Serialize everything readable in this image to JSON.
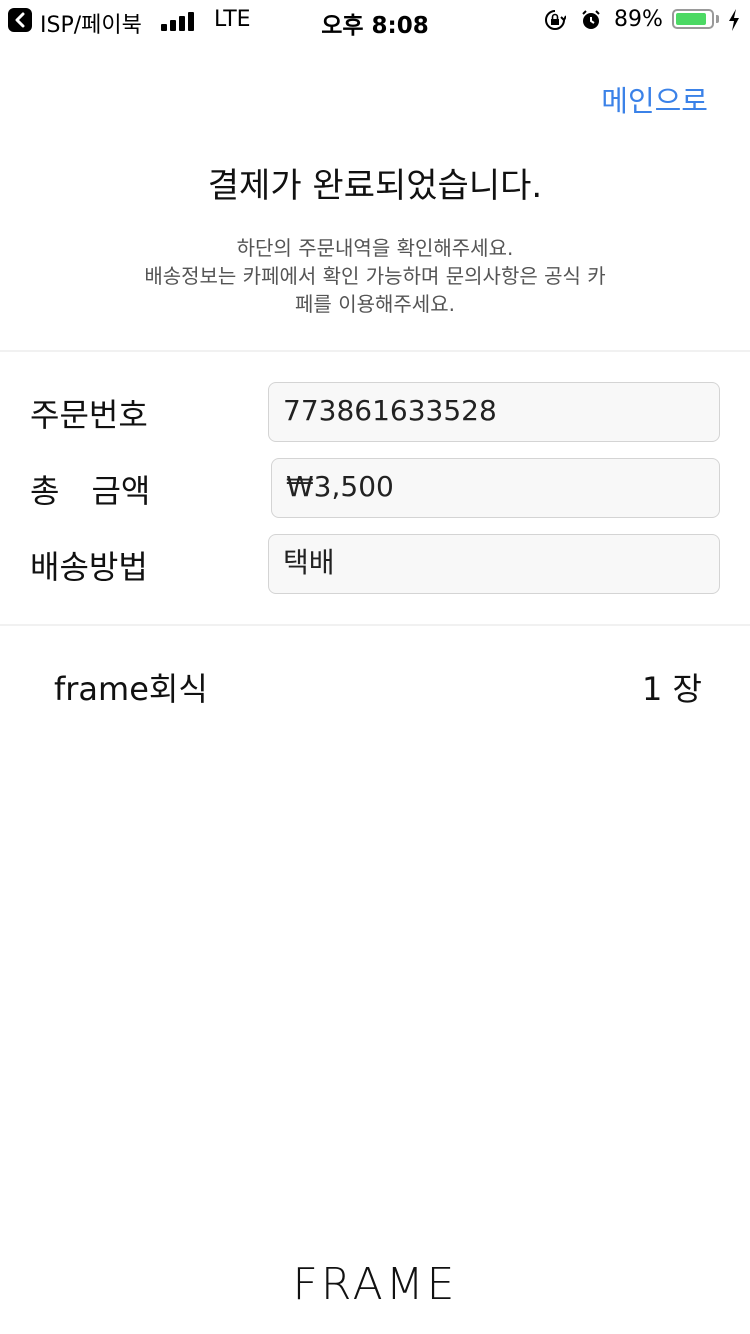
{
  "status_bar": {
    "back_app": "ISP/페이북",
    "network": "LTE",
    "time": "오후 8:08",
    "battery_percent": "89%",
    "battery_level": 0.89,
    "battery_color": "#4cd964"
  },
  "header": {
    "main_link": "메인으로",
    "title": "결제가 완료되었습니다.",
    "description_line1": "하단의 주문내역을 확인해주세요.",
    "description_line2": "배송정보는 카페에서 확인 가능하며 문의사항은 공식 카",
    "description_line3": "페를 이용해주세요."
  },
  "order": {
    "number_label": "주문번호",
    "number_value": "773861633528",
    "total_label": "총　금액",
    "total_value": "₩3,500",
    "shipping_label": "배송방법",
    "shipping_value": "택배"
  },
  "items": [
    {
      "name": "frame회식",
      "quantity": "1 장"
    }
  ],
  "footer": {
    "logo": "FRAME"
  },
  "colors": {
    "accent": "#3b82e8"
  }
}
